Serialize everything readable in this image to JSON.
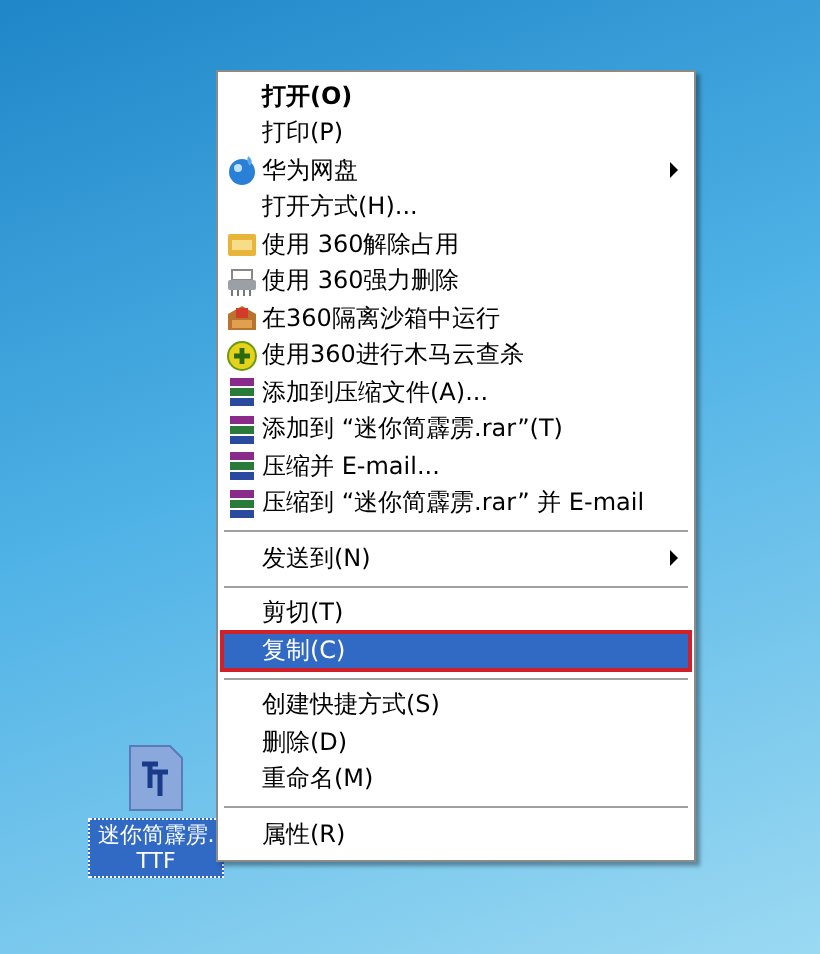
{
  "menu": {
    "items": [
      {
        "kind": "item",
        "label": "打开(O)",
        "bold": true,
        "has_icon": false,
        "submenu": false,
        "selected": false
      },
      {
        "kind": "item",
        "label": "打印(P)",
        "bold": false,
        "has_icon": false,
        "submenu": false,
        "selected": false
      },
      {
        "kind": "item",
        "label": "华为网盘",
        "bold": false,
        "has_icon": true,
        "submenu": true,
        "selected": false
      },
      {
        "kind": "item",
        "label": "打开方式(H)...",
        "bold": false,
        "has_icon": false,
        "submenu": false,
        "selected": false
      },
      {
        "kind": "item",
        "label": "使用 360解除占用",
        "bold": false,
        "has_icon": true,
        "submenu": false,
        "selected": false
      },
      {
        "kind": "item",
        "label": "使用 360强力删除",
        "bold": false,
        "has_icon": true,
        "submenu": false,
        "selected": false
      },
      {
        "kind": "item",
        "label": "在360隔离沙箱中运行",
        "bold": false,
        "has_icon": true,
        "submenu": false,
        "selected": false
      },
      {
        "kind": "item",
        "label": "使用360进行木马云查杀",
        "bold": false,
        "has_icon": true,
        "submenu": false,
        "selected": false
      },
      {
        "kind": "item",
        "label": "添加到压缩文件(A)...",
        "bold": false,
        "has_icon": true,
        "submenu": false,
        "selected": false
      },
      {
        "kind": "item",
        "label": "添加到 “迷你简霹雳.rar”(T)",
        "bold": false,
        "has_icon": true,
        "submenu": false,
        "selected": false
      },
      {
        "kind": "item",
        "label": "压缩并 E-mail...",
        "bold": false,
        "has_icon": true,
        "submenu": false,
        "selected": false
      },
      {
        "kind": "item",
        "label": "压缩到 “迷你简霹雳.rar” 并 E-mail",
        "bold": false,
        "has_icon": true,
        "submenu": false,
        "selected": false
      },
      {
        "kind": "separator"
      },
      {
        "kind": "item",
        "label": "发送到(N)",
        "bold": false,
        "has_icon": false,
        "submenu": true,
        "selected": false
      },
      {
        "kind": "separator"
      },
      {
        "kind": "item",
        "label": "剪切(T)",
        "bold": false,
        "has_icon": false,
        "submenu": false,
        "selected": false
      },
      {
        "kind": "item",
        "label": "复制(C)",
        "bold": false,
        "has_icon": false,
        "submenu": false,
        "selected": true
      },
      {
        "kind": "separator"
      },
      {
        "kind": "item",
        "label": "创建快捷方式(S)",
        "bold": false,
        "has_icon": false,
        "submenu": false,
        "selected": false
      },
      {
        "kind": "item",
        "label": "删除(D)",
        "bold": false,
        "has_icon": false,
        "submenu": false,
        "selected": false
      },
      {
        "kind": "item",
        "label": "重命名(M)",
        "bold": false,
        "has_icon": false,
        "submenu": false,
        "selected": false
      },
      {
        "kind": "separator"
      },
      {
        "kind": "item",
        "label": "属性(R)",
        "bold": false,
        "has_icon": false,
        "submenu": false,
        "selected": false
      }
    ]
  },
  "desktop_icon": {
    "label": "迷你简霹雳.TTF",
    "selected": true
  }
}
